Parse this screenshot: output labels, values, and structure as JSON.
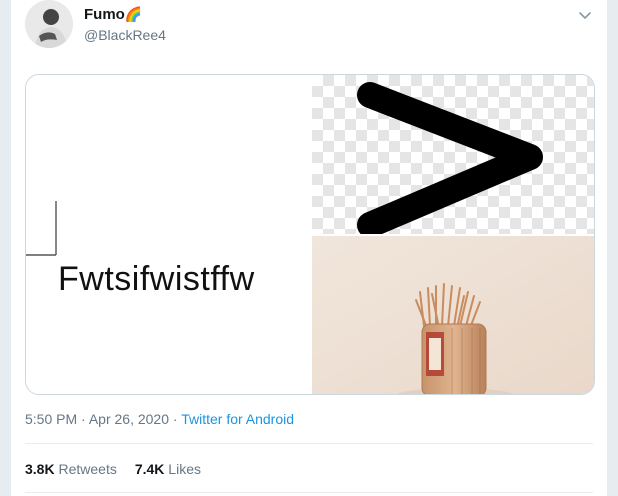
{
  "author": {
    "name": "Fumo",
    "emoji": "🌈",
    "handle": "@BlackRee4"
  },
  "media": {
    "meme_text": "Fwtsifwistffw"
  },
  "meta": {
    "time": "5:50 PM",
    "separator": "·",
    "date": "Apr 26, 2020",
    "source": "Twitter for Android"
  },
  "stats": {
    "retweets_count": "3.8K",
    "retweets_label": "Retweets",
    "likes_count": "7.4K",
    "likes_label": "Likes"
  },
  "colors": {
    "link": "#1b95e0",
    "secondary_text": "#657786",
    "border": "#e6ecf0"
  },
  "icons": [
    "chevron-down-icon"
  ]
}
